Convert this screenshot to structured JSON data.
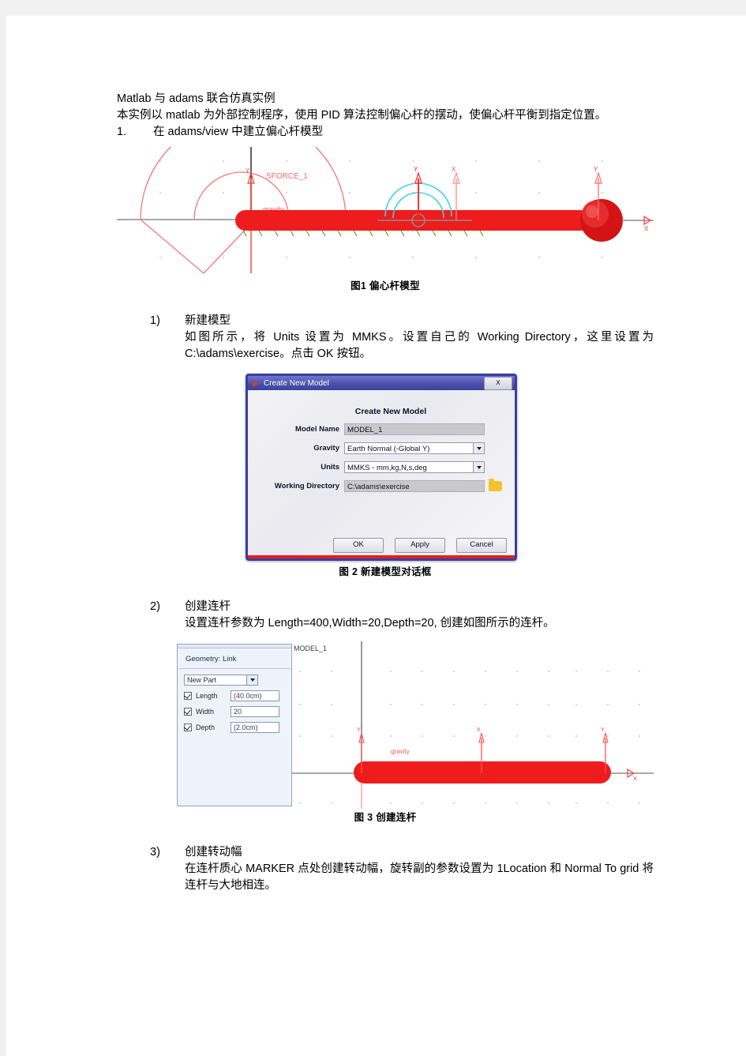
{
  "document": {
    "title_line": "Matlab 与 adams 联合仿真实例",
    "intro": "本实例以 matlab 为外部控制程序，使用 PID 算法控制偏心杆的摆动，使偏心杆平衡到指定位置。",
    "sections": [
      {
        "marker": "1.",
        "heading": "在 adams/view 中建立偏心杆模型"
      }
    ],
    "steps": [
      {
        "marker": "1)",
        "title": "新建模型",
        "body": "如图所示，将 Units 设置为 MMKS。设置自己的 Working Directory，这里设置为 C:\\adams\\exercise。点击 OK 按钮。"
      },
      {
        "marker": "2)",
        "title": "创建连杆",
        "body": "设置连杆参数为 Length=400,Width=20,Depth=20, 创建如图所示的连杆。"
      },
      {
        "marker": "3)",
        "title": "创建转动幅",
        "body": "在连杆质心 MARKER 点处创建转动幅，旋转副的参数设置为 1Location 和 Normal To grid 将连杆与大地相连。"
      }
    ],
    "captions": {
      "fig1": "图1  偏心杆模型",
      "fig2": "图 2  新建模型对话框",
      "fig3": "图 3  创建连杆"
    }
  },
  "figure1": {
    "labels": {
      "sforce": "SFORCE_1",
      "gravity": "gravity",
      "axis_y1": "Y",
      "axis_y2": "Y",
      "axis_x2": "X",
      "axis_y3": "Y",
      "axis_x_global": "X"
    },
    "colors": {
      "link": "#ee1c1c",
      "marker": "#ff3b30",
      "joint": "#3fd0e8",
      "ground": "#8c8c8c",
      "grid": "#bdbdbd"
    }
  },
  "dialog": {
    "window_title": "Create New Model",
    "close_label": "x",
    "heading": "Create New Model",
    "fields": [
      {
        "label": "Model Name",
        "value": "MODEL_1",
        "type": "text-readonly"
      },
      {
        "label": "Gravity",
        "value": "Earth Normal (-Global Y)",
        "type": "select"
      },
      {
        "label": "Units",
        "value": "MMKS - mm,kg,N,s,deg",
        "type": "select"
      },
      {
        "label": "Working Directory",
        "value": "C:\\adams\\exercise",
        "type": "text-readonly-browse"
      }
    ],
    "buttons": [
      "OK",
      "Apply",
      "Cancel"
    ],
    "colors": {
      "title_bar": "#3b429d",
      "accent_bottom": "#e12020",
      "folder": "#f2c230"
    }
  },
  "geometry_panel": {
    "title": "Geometry: Link",
    "part_select": "New Part",
    "rows": [
      {
        "label": "Length",
        "value": "(40.0cm)",
        "checked": true
      },
      {
        "label": "Width",
        "value": "20",
        "checked": true
      },
      {
        "label": "Depth",
        "value": "(2.0cm)",
        "checked": true
      }
    ]
  },
  "viewport3": {
    "model_label": "MODEL_1",
    "gravity_label": "gravity",
    "markers": [
      {
        "label": "Y"
      },
      {
        "label": "X"
      },
      {
        "label": "Y"
      }
    ],
    "axis_x_label": "X"
  }
}
